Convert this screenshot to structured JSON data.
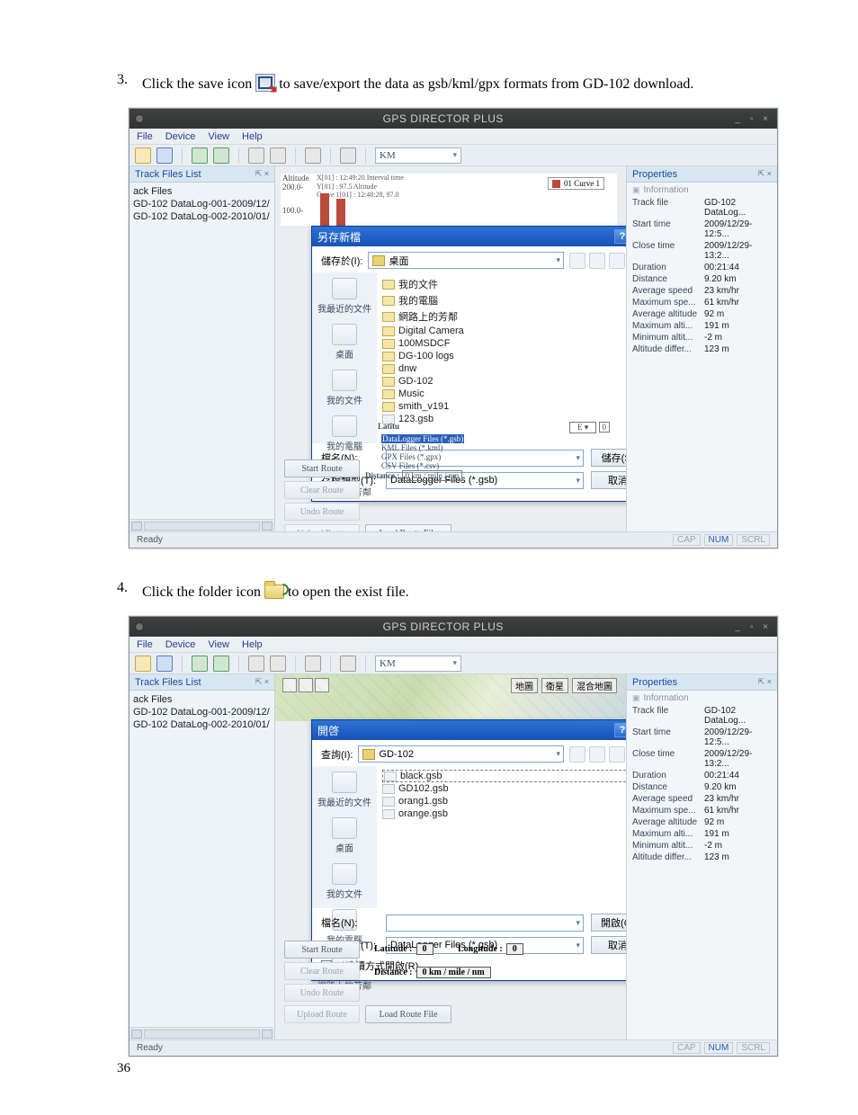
{
  "page_number": "36",
  "steps": {
    "s3": {
      "num": "3.",
      "before": "Click the save icon",
      "after": " to save/export the data as gsb/kml/gpx formats from GD-102 download."
    },
    "s4": {
      "num": "4.",
      "before": "Click the folder icon ",
      "after": " to open the exist file."
    }
  },
  "app": {
    "title": "GPS DIRECTOR PLUS",
    "winctrls": "_  ▫  ×",
    "menu": [
      "File",
      "Device",
      "View",
      "Help"
    ],
    "unit": "KM",
    "track_list_header": "Track Files List",
    "track_group": "ack Files",
    "tracks": [
      "GD-102 DataLog-001-2009/12/",
      "GD-102 DataLog-002-2010/01/"
    ],
    "props_header": "Properties",
    "info_label": "Information",
    "props": [
      {
        "k": "Track file",
        "v": "GD-102 DataLog..."
      },
      {
        "k": "Start time",
        "v": "2009/12/29-12:5..."
      },
      {
        "k": "Close time",
        "v": "2009/12/29-13:2..."
      },
      {
        "k": "Duration",
        "v": "00:21:44"
      },
      {
        "k": "Distance",
        "v": "9.20 km"
      },
      {
        "k": "Average speed",
        "v": "23 km/hr"
      },
      {
        "k": "Maximum spe...",
        "v": "61 km/hr"
      },
      {
        "k": "Average altitude",
        "v": "92 m"
      },
      {
        "k": "Maximum alti...",
        "v": "191 m"
      },
      {
        "k": "Minimum altit...",
        "v": "-2 m"
      },
      {
        "k": "Altitude differ...",
        "v": "123 m"
      }
    ],
    "status_ready": "Ready",
    "status_segs": [
      "CAP",
      "NUM",
      "SCRL"
    ],
    "route_btns": {
      "start": "Start Route",
      "clear": "Clear Route",
      "undo": "Undo Route",
      "upload": "Upload Route",
      "load": "Load Route File"
    },
    "chart": {
      "altitude_lbl": "Altitude",
      "y200": "200.0-",
      "y100": "100.0-",
      "x_note1": "X[01] : 12:49:20 Interval time",
      "x_note2": "Y[01] : 97.5 Altitude",
      "x_note3": "Curve 1[01] : 12:48:28, 97.0",
      "legend": "01 Curve 1"
    },
    "under1": {
      "latitu": "Latitu",
      "distance_lbl": "Distance :",
      "distance_val": "0 km / mile / nm",
      "fmtlist": [
        "DataLogger Files (*.gsb)",
        "KML Files (*.kml)",
        "GPX Files (*.gpx)",
        "CSV Files (*.csv)"
      ]
    },
    "under2": {
      "lat_lbl": "Latitude :",
      "lat_v": "0",
      "lon_lbl": "Longitude :",
      "lon_v": "0",
      "dist_lbl": "Distance :",
      "dist_v": "0 km / mile / nm"
    }
  },
  "save_dialog": {
    "title": "另存新檔",
    "lookin_lbl": "儲存於(I):",
    "lookin_val": "桌面",
    "side": [
      {
        "lbl": "我最近的文件"
      },
      {
        "lbl": "桌面"
      },
      {
        "lbl": "我的文件"
      },
      {
        "lbl": "我的電腦"
      },
      {
        "lbl": "網路上的芳鄰"
      }
    ],
    "folders": [
      "我的文件",
      "我的電腦",
      "網路上的芳鄰",
      "Digital Camera",
      "100MSDCF",
      "DG-100 logs",
      "dnw",
      "GD-102",
      "Music",
      "smith_v191",
      "123.gsb"
    ],
    "filename_lbl": "檔名(N):",
    "filetype_lbl": "存檔類型(T):",
    "filetype_val": "DataLogger Files (*.gsb)",
    "btn_save": "儲存(S)",
    "btn_cancel": "取消"
  },
  "open_dialog": {
    "title": "開啓",
    "lookin_lbl": "查詢(I):",
    "lookin_val": "GD-102",
    "side": [
      {
        "lbl": "我最近的文件"
      },
      {
        "lbl": "桌面"
      },
      {
        "lbl": "我的文件"
      },
      {
        "lbl": "我的電腦"
      },
      {
        "lbl": "網路上的芳鄰"
      }
    ],
    "files": [
      "black.gsb",
      "GD102.gsb",
      "orang1.gsb",
      "orange.gsb"
    ],
    "filename_lbl": "檔名(N):",
    "filetype_lbl": "檔案類型(T):",
    "filetype_val": "DataLogger Files (*.gsb)",
    "readonly_lbl": "以唯讀方式開啟(R)",
    "btn_open": "開啟(O)",
    "btn_cancel": "取消"
  },
  "map_controls": {
    "tabs": [
      "地圖",
      "衛星",
      "混合地圖"
    ]
  }
}
